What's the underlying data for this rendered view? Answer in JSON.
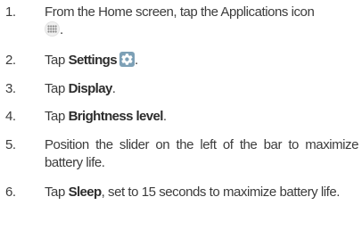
{
  "steps": [
    {
      "number": "1.",
      "text_before": "From the Home screen, tap the Applications icon",
      "text_after": "."
    },
    {
      "number": "2.",
      "text_before": "Tap ",
      "bold": "Settings",
      "text_after": "."
    },
    {
      "number": "3.",
      "text_before": "Tap ",
      "bold": "Display",
      "text_after": "."
    },
    {
      "number": "4.",
      "text_before": "Tap ",
      "bold": "Brightness level",
      "text_after": "."
    },
    {
      "number": "5.",
      "text": "Position the slider on the left of the bar to maximize battery life."
    },
    {
      "number": "6.",
      "text_before": "Tap ",
      "bold": "Sleep",
      "text_after": ", set to 15 seconds to maximize battery life."
    }
  ],
  "icons": {
    "applications": "apps-grid-icon",
    "settings": "gear-icon"
  }
}
